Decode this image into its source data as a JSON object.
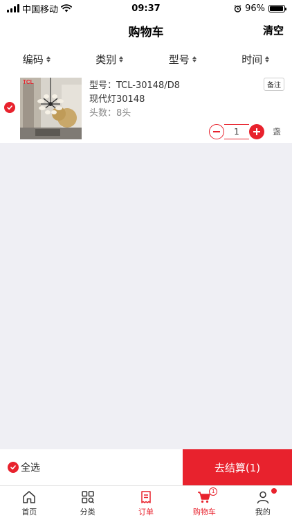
{
  "status_bar": {
    "carrier": "中国移动",
    "time": "09:37",
    "battery": "96%",
    "battery_level": 0.96,
    "icons": [
      "signal-icon",
      "wifi-icon",
      "alarm-icon",
      "battery-icon"
    ]
  },
  "nav": {
    "title": "购物车",
    "clear_label": "清空"
  },
  "sort_options": [
    {
      "label": "编码"
    },
    {
      "label": "类别"
    },
    {
      "label": "型号"
    },
    {
      "label": "时间"
    }
  ],
  "items": [
    {
      "selected": true,
      "brand": "TCL",
      "model_line": "型号：TCL-30148/D8",
      "name": "现代灯30148",
      "specs": "头数：8头",
      "remark_label": "备注",
      "quantity": "1",
      "unit": "盏"
    }
  ],
  "checkout": {
    "select_all_label": "全选",
    "checkout_label": "去结算(1)"
  },
  "tabs": [
    {
      "label": "首页",
      "icon": "home-icon",
      "active": false
    },
    {
      "label": "分类",
      "icon": "category-icon",
      "active": false
    },
    {
      "label": "订单",
      "icon": "order-icon",
      "active": false
    },
    {
      "label": "购物车",
      "icon": "cart-icon",
      "active": true,
      "badge": "1"
    },
    {
      "label": "我的",
      "icon": "profile-icon",
      "active": false,
      "dot": true
    }
  ],
  "colors": {
    "accent": "#e8222d",
    "background": "#efeff4",
    "surface": "#ffffff"
  }
}
